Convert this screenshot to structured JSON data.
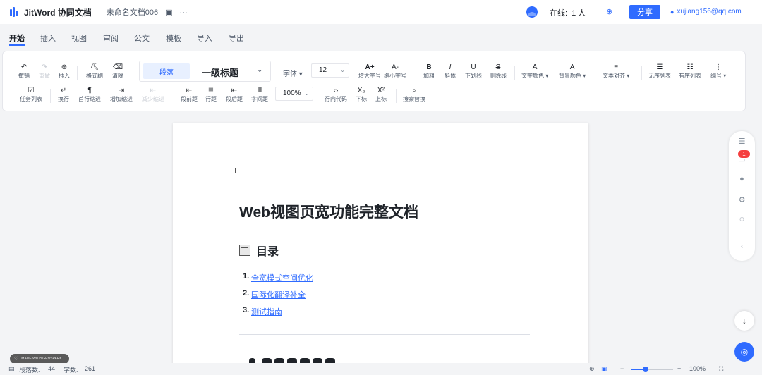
{
  "app": {
    "brand": "JitWord 协同文档",
    "doc_title": "未命名文档006",
    "online_label": "在线:",
    "online_count": "1 人",
    "share_label": "分享",
    "user_email": "xujiang156@qq.com"
  },
  "menu_tabs": [
    "开始",
    "插入",
    "视图",
    "审阅",
    "公文",
    "模板",
    "导入",
    "导出"
  ],
  "toolbar": {
    "undo": "撤销",
    "redo": "重做",
    "insert": "插入",
    "format_painter": "格式刷",
    "clear": "清除",
    "para_tag": "段落",
    "heading_value": "一级标题",
    "font_label": "字体",
    "font_size": "12",
    "grow": "增大字号",
    "shrink": "缩小字号",
    "bold": "加粗",
    "italic": "斜体",
    "underline": "下划线",
    "strike": "删除线",
    "text_color": "文字颜色",
    "bg_color": "背景颜色",
    "align": "文本对齐",
    "bullet": "无序列表",
    "ordered": "有序列表",
    "number": "编号",
    "task": "任务列表",
    "wrap": "换行",
    "first_indent": "首行缩进",
    "add_indent": "增加缩进",
    "reduce_indent": "减少缩进",
    "para_before": "段前距",
    "line_height": "行距",
    "para_after": "段后距",
    "letter_spacing": "字间距",
    "zoom": "100%",
    "inline_code": "行内代码",
    "subscript": "下标",
    "superscript": "上标",
    "find_replace": "搜索替换",
    "icons": {
      "undo": "↶",
      "redo": "↷",
      "insert": "⊕",
      "format_painter": "⛏",
      "clear": "⌫",
      "grow": "A+",
      "shrink": "A-",
      "bold": "B",
      "italic": "I",
      "underline": "U",
      "strike": "S",
      "text_color": "A",
      "bg_color": "A",
      "align": "≡",
      "bullet": "☰",
      "ordered": "☷",
      "number": "⋮",
      "task": "☑",
      "wrap": "↵",
      "first_indent": "¶",
      "add_indent": "⇥",
      "reduce_indent": "⇤",
      "para_before": "⇤",
      "line_height": "≣",
      "para_after": "⇤",
      "letter_spacing": "Ⅲ",
      "inline_code": "‹›",
      "subscript": "X₂",
      "superscript": "X²",
      "find_replace": "⌕"
    }
  },
  "document": {
    "title": "Web视图页宽功能完整文档",
    "toc_heading": "目录",
    "toc": [
      {
        "num": "1.",
        "text": "全宽模式空间优化"
      },
      {
        "num": "2.",
        "text": "国际化翻译补全"
      },
      {
        "num": "3.",
        "text": "测试指南"
      }
    ]
  },
  "right_panel": {
    "badge": "1"
  },
  "status": {
    "made_with": "MADE WITH GENSPARK",
    "para_label": "段落数:",
    "para_count": "44",
    "word_label": "字数:",
    "word_count": "261",
    "zoom": "100%",
    "zoom_fraction": 0.35
  },
  "colors": {
    "accent": "#2f6bff",
    "badge": "#f53f3f"
  }
}
